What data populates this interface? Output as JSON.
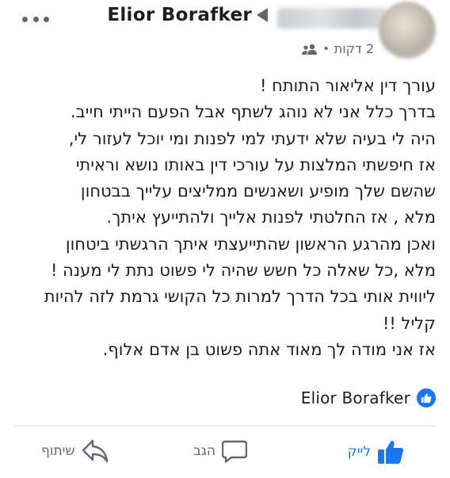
{
  "header": {
    "author_name": "Elior Borafker",
    "time_label": "2 דקות",
    "audience_icon": "friends-icon",
    "more_icon": "more-options-icon"
  },
  "post": {
    "lines": [
      "עורך דין אליאור התותח !",
      "בדרך כלל אני לא נוהג לשתף אבל הפעם הייתי חייב.",
      "היה לי בעיה שלא ידעתי למי לפנות ומי יוכל לעזור לי,",
      "אז חיפשתי המלצות על עורכי דין באותו נושא וראיתי",
      "שהשם שלך מופיע ושאנשים ממליצים עלייך בבטחון",
      "מלא , אז החלטתי לפנות אלייך ולהתייעץ איתך.",
      "ואכן מהרגע הראשון שהתייעצתי איתך הרגשתי ביטחון",
      "מלא ,כל שאלה כל חשש שהיה לי פשוט נתת לי מענה !",
      "ליווית אותי בכל הדרך למרות כל הקושי גרמת לזה להיות",
      "קליל !!",
      "אז אני מודה לך מאוד אתה פשוט בן אדם אלוף."
    ]
  },
  "reaction": {
    "name": "Elior Borafker",
    "icon": "like-reaction-icon",
    "color": "#1877f2"
  },
  "actions": {
    "like_label": "לייק",
    "comment_label": "הגב",
    "share_label": "שיתוף"
  },
  "colors": {
    "accent": "#1877f2",
    "secondary_text": "#606770",
    "primary_text": "#1c1e21"
  }
}
